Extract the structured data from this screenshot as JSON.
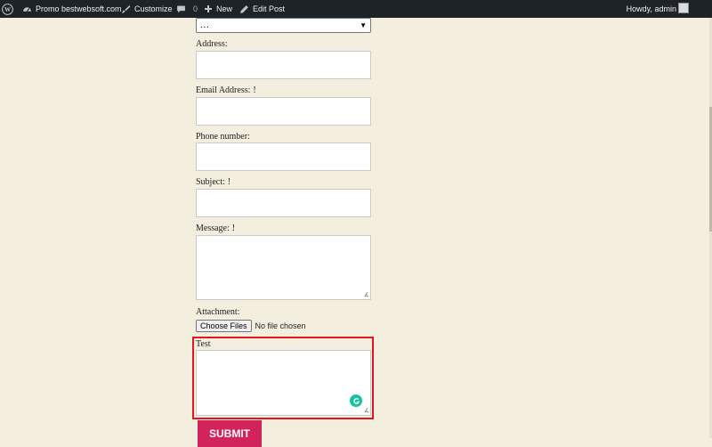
{
  "admin_bar": {
    "site_name": "Promo bestwebsoft.com",
    "customize": "Customize",
    "comments_count": "0",
    "new_label": "New",
    "edit_post": "Edit Post",
    "howdy": "Howdy, admin"
  },
  "form": {
    "select_value": "…",
    "address_label": "Address:",
    "email_label": "Email Address:",
    "email_required": "!",
    "phone_label": "Phone number:",
    "subject_label": "Subject:",
    "subject_required": "!",
    "message_label": "Message:",
    "message_required": "!",
    "attachment_label": "Attachment:",
    "choose_files": "Choose Files",
    "no_file": "No file chosen",
    "test_label": "Test",
    "submit_label": "SUBMIT"
  },
  "colors": {
    "background": "#f4eedf",
    "admin_bar": "#1d2327",
    "submit": "#d2245b",
    "highlight": "#e0171f",
    "grammarly": "#15c39a"
  }
}
